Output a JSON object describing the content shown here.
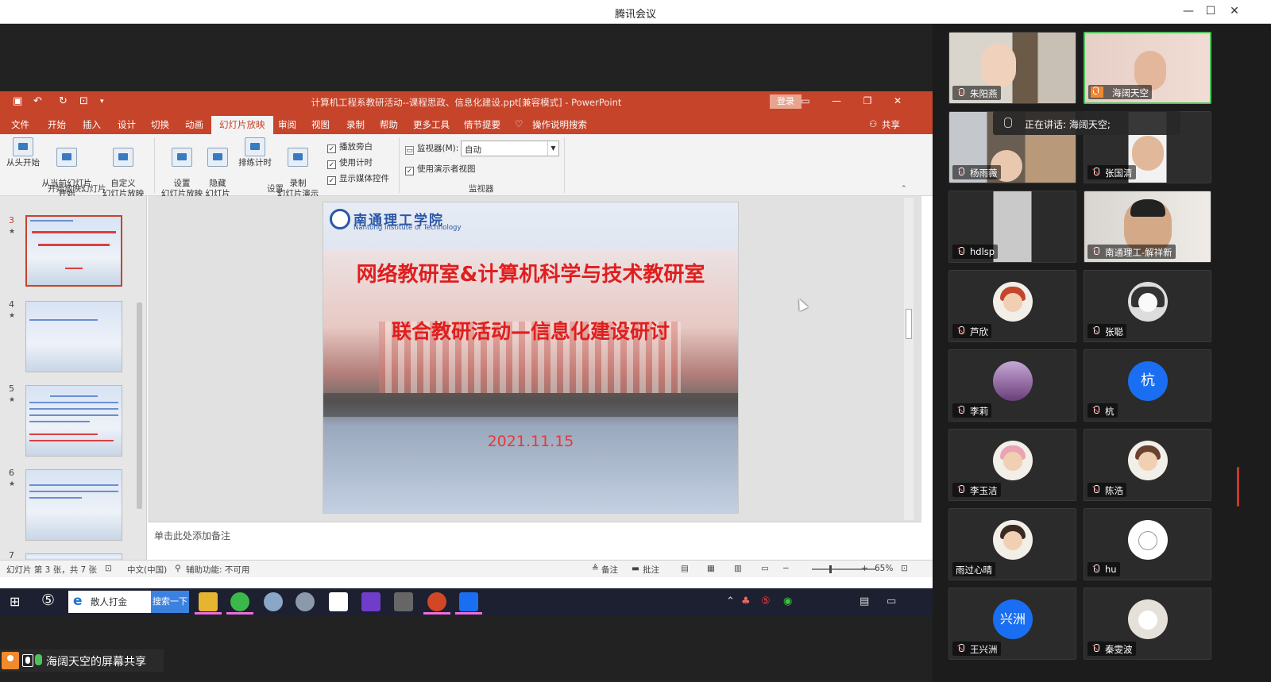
{
  "app": {
    "title": "腾讯会议"
  },
  "ppt": {
    "title": "计算机工程系教研活动--课程思政、信息化建设.ppt[兼容模式] - PowerPoint",
    "login": "登录",
    "tabs": [
      "文件",
      "开始",
      "插入",
      "设计",
      "切换",
      "动画",
      "幻灯片放映",
      "审阅",
      "视图",
      "录制",
      "帮助",
      "更多工具",
      "情节提要"
    ],
    "active_tab": "幻灯片放映",
    "tell_me": "操作说明搜索",
    "share": "共享",
    "ribbon": {
      "from_start": "从头开始",
      "from_current": "从当前幻灯片\n开始",
      "custom": "自定义\n幻灯片放映",
      "setup": "设置\n幻灯片放映",
      "hide": "隐藏\n幻灯片",
      "rehearse": "排练计时",
      "record": "录制\n幻灯片演示",
      "play_narration": "播放旁白",
      "use_timing": "使用计时",
      "show_media": "显示媒体控件",
      "monitor_label": "监视器(M):",
      "monitor_value": "自动",
      "presenter_view": "使用演示者视图",
      "group_start": "开始放映幻灯片",
      "group_setup": "设置",
      "group_monitor": "监视器"
    },
    "thumbs": [
      {
        "num": "3",
        "star": "★"
      },
      {
        "num": "4",
        "star": "★"
      },
      {
        "num": "5",
        "star": "★"
      },
      {
        "num": "6",
        "star": "★"
      },
      {
        "num": "7",
        "star": ""
      }
    ],
    "slide": {
      "school_cn": "南通理工学院",
      "school_en": "Nantong Institute of Technology",
      "heading1": "网络教研室&计算机科学与技术教研室",
      "heading2": "联合教研活动—信息化建设研讨",
      "date": "2021.11.15"
    },
    "notes_placeholder": "单击此处添加备注",
    "status": {
      "slide_info": "幻灯片 第 3 张，共 7 张",
      "language": "中文(中国)",
      "accessibility": "辅助功能: 不可用",
      "notes": "备注",
      "comments": "批注",
      "zoom": "65%"
    }
  },
  "taskbar": {
    "ie_label": "散人打金",
    "search_btn": "搜索一下"
  },
  "share_label": "海阔天空的屏幕共享",
  "speaking": "正在讲话: 海阔天空;",
  "participants": [
    {
      "name": "朱阳燕"
    },
    {
      "name": "海阔天空"
    },
    {
      "name": "杨雨薇"
    },
    {
      "name": "张国清"
    },
    {
      "name": "hdlsp"
    },
    {
      "name": "南通理工-解祥新"
    },
    {
      "name": "芦欣"
    },
    {
      "name": "张聪"
    },
    {
      "name": "李莉"
    },
    {
      "name": "杭",
      "avatar_text": "杭"
    },
    {
      "name": "李玉洁"
    },
    {
      "name": "陈浩"
    },
    {
      "name": "雨过心晴"
    },
    {
      "name": "hu"
    },
    {
      "name": "王兴洲",
      "avatar_text": "兴洲"
    },
    {
      "name": "秦雯波"
    }
  ]
}
